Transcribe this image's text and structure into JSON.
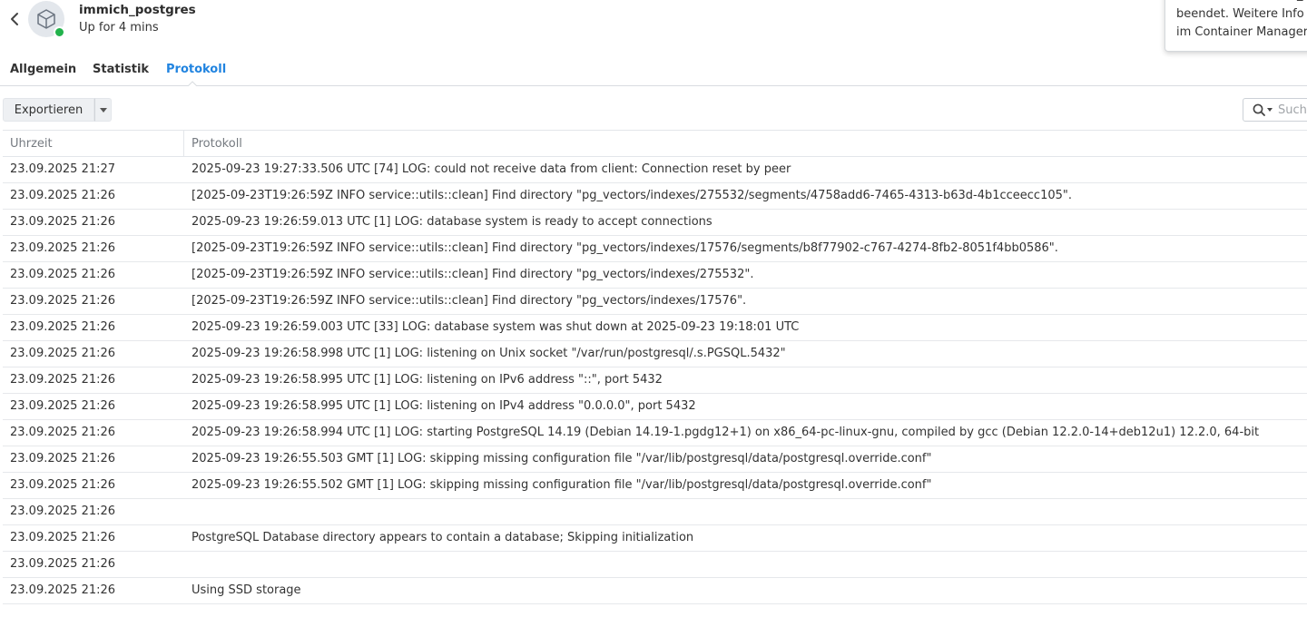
{
  "header": {
    "title": "immich_postgres",
    "status": "Up for 4 mins",
    "status_color": "#22b24c"
  },
  "notification": {
    "partial_top": "_",
    "line1": "beendet. Weitere Info",
    "line2": "im Container Manager"
  },
  "tabs": [
    {
      "label": "Allgemein",
      "active": false
    },
    {
      "label": "Statistik",
      "active": false
    },
    {
      "label": "Protokoll",
      "active": true
    }
  ],
  "toolbar": {
    "export_label": "Exportieren",
    "search_placeholder": "Such"
  },
  "table": {
    "columns": [
      "Uhrzeit",
      "Protokoll"
    ],
    "rows": [
      {
        "time": "23.09.2025 21:27",
        "message": "2025-09-23 19:27:33.506 UTC [74] LOG: could not receive data from client: Connection reset by peer"
      },
      {
        "time": "23.09.2025 21:26",
        "message": "[2025-09-23T19:26:59Z INFO service::utils::clean] Find directory \"pg_vectors/indexes/275532/segments/4758add6-7465-4313-b63d-4b1cceecc105\"."
      },
      {
        "time": "23.09.2025 21:26",
        "message": "2025-09-23 19:26:59.013 UTC [1] LOG: database system is ready to accept connections"
      },
      {
        "time": "23.09.2025 21:26",
        "message": "[2025-09-23T19:26:59Z INFO service::utils::clean] Find directory \"pg_vectors/indexes/17576/segments/b8f77902-c767-4274-8fb2-8051f4bb0586\"."
      },
      {
        "time": "23.09.2025 21:26",
        "message": "[2025-09-23T19:26:59Z INFO service::utils::clean] Find directory \"pg_vectors/indexes/275532\"."
      },
      {
        "time": "23.09.2025 21:26",
        "message": "[2025-09-23T19:26:59Z INFO service::utils::clean] Find directory \"pg_vectors/indexes/17576\"."
      },
      {
        "time": "23.09.2025 21:26",
        "message": "2025-09-23 19:26:59.003 UTC [33] LOG: database system was shut down at 2025-09-23 19:18:01 UTC"
      },
      {
        "time": "23.09.2025 21:26",
        "message": "2025-09-23 19:26:58.998 UTC [1] LOG: listening on Unix socket \"/var/run/postgresql/.s.PGSQL.5432\""
      },
      {
        "time": "23.09.2025 21:26",
        "message": "2025-09-23 19:26:58.995 UTC [1] LOG: listening on IPv6 address \"::\", port 5432"
      },
      {
        "time": "23.09.2025 21:26",
        "message": "2025-09-23 19:26:58.995 UTC [1] LOG: listening on IPv4 address \"0.0.0.0\", port 5432"
      },
      {
        "time": "23.09.2025 21:26",
        "message": "2025-09-23 19:26:58.994 UTC [1] LOG: starting PostgreSQL 14.19 (Debian 14.19-1.pgdg12+1) on x86_64-pc-linux-gnu, compiled by gcc (Debian 12.2.0-14+deb12u1) 12.2.0, 64-bit"
      },
      {
        "time": "23.09.2025 21:26",
        "message": "2025-09-23 19:26:55.503 GMT [1] LOG: skipping missing configuration file \"/var/lib/postgresql/data/postgresql.override.conf\""
      },
      {
        "time": "23.09.2025 21:26",
        "message": "2025-09-23 19:26:55.502 GMT [1] LOG: skipping missing configuration file \"/var/lib/postgresql/data/postgresql.override.conf\""
      },
      {
        "time": "23.09.2025 21:26",
        "message": ""
      },
      {
        "time": "23.09.2025 21:26",
        "message": "PostgreSQL Database directory appears to contain a database; Skipping initialization"
      },
      {
        "time": "23.09.2025 21:26",
        "message": ""
      },
      {
        "time": "23.09.2025 21:26",
        "message": "Using SSD storage"
      }
    ]
  },
  "icons": {
    "back": "chevron-left-icon",
    "container": "cube-icon",
    "export_dropdown": "caret-down-icon",
    "search": "search-icon",
    "search_dropdown": "caret-down-icon"
  },
  "colors": {
    "accent": "#2184e0",
    "running": "#22b24c"
  }
}
